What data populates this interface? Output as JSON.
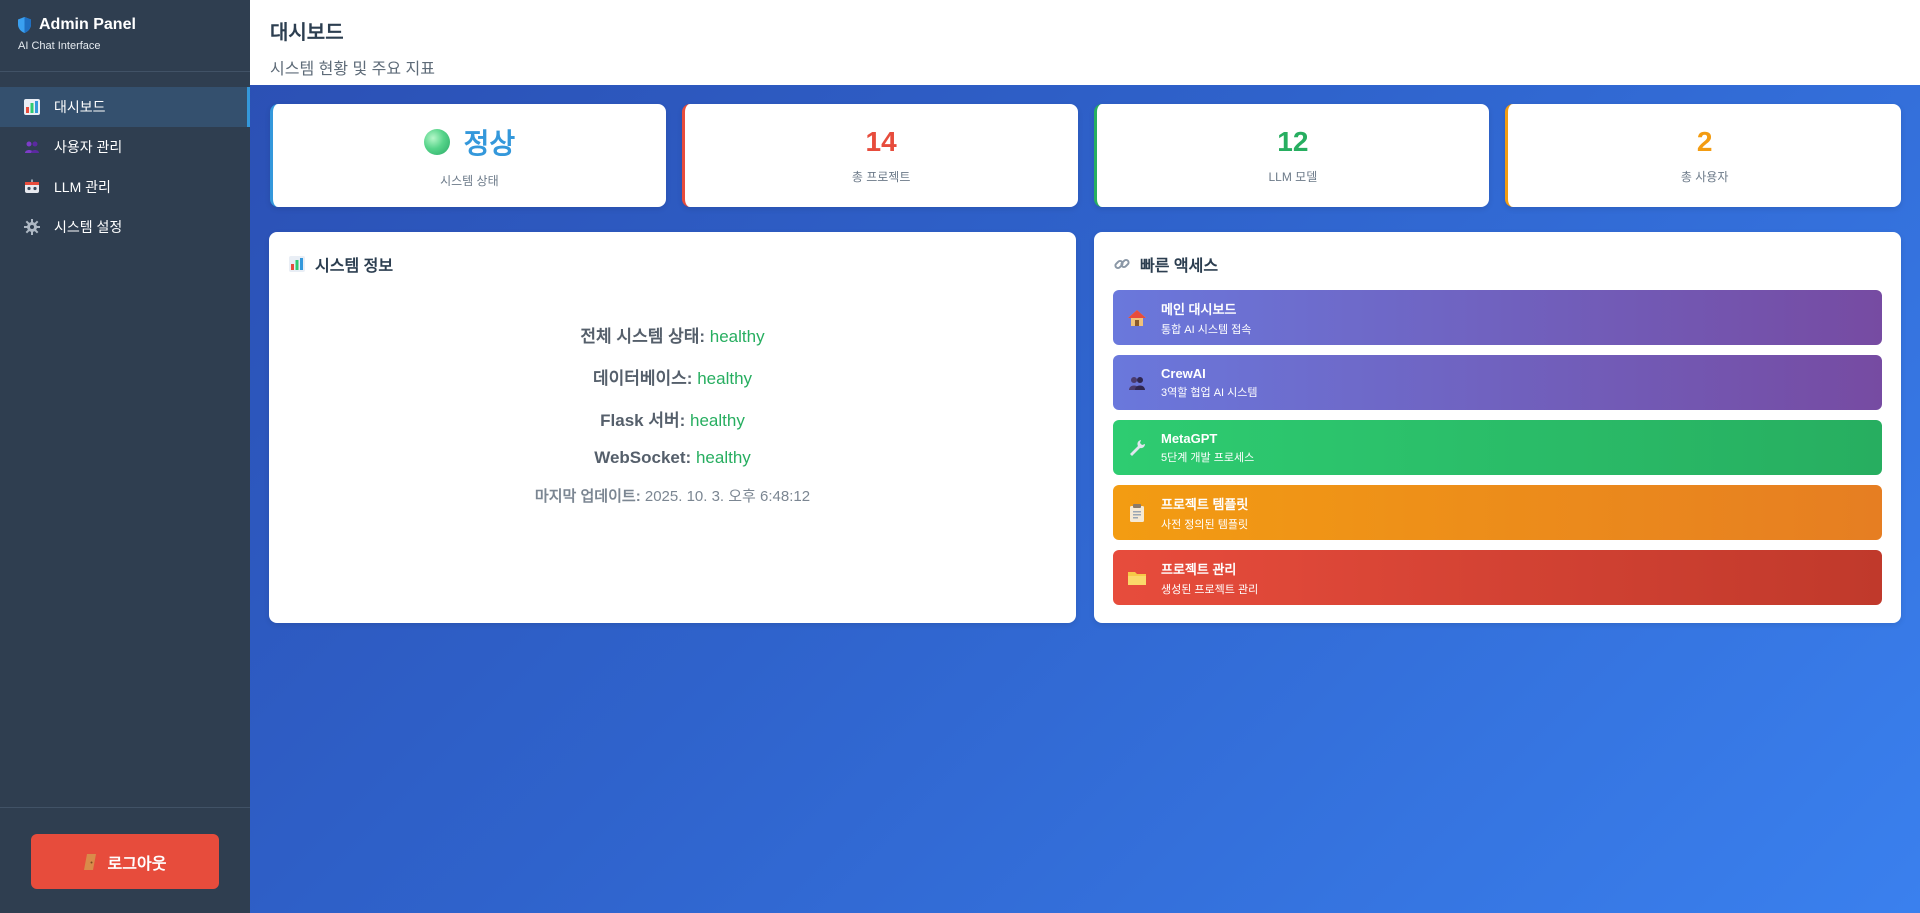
{
  "sidebar": {
    "title": "Admin Panel",
    "subtitle": "AI Chat Interface",
    "items": [
      {
        "label": "대시보드",
        "icon": "bar-chart-icon",
        "active": true
      },
      {
        "label": "사용자 관리",
        "icon": "users-icon"
      },
      {
        "label": "LLM 관리",
        "icon": "robot-icon"
      },
      {
        "label": "시스템 설정",
        "icon": "gear-icon"
      }
    ],
    "logout_label": "로그아웃"
  },
  "header": {
    "title": "대시보드",
    "subtitle": "시스템 현황 및 주요 지표"
  },
  "stats": [
    {
      "value": "정상",
      "label": "시스템 상태",
      "color": "#3498db"
    },
    {
      "value": "14",
      "label": "총 프로젝트",
      "color": "#e74c3c"
    },
    {
      "value": "12",
      "label": "LLM 모델",
      "color": "#27ae60"
    },
    {
      "value": "2",
      "label": "총 사용자",
      "color": "#f39c12"
    }
  ],
  "system_info": {
    "title": "시스템 정보",
    "rows": [
      {
        "label": "전체 시스템 상태:",
        "value": "healthy"
      },
      {
        "label": "데이터베이스:",
        "value": "healthy"
      },
      {
        "label": "Flask 서버:",
        "value": "healthy"
      },
      {
        "label": "WebSocket:",
        "value": "healthy"
      }
    ],
    "update_label": "마지막 업데이트:",
    "update_value": "2025. 10. 3. 오후 6:48:12"
  },
  "quick_access": {
    "title": "빠른 액세스",
    "items": [
      {
        "title": "메인 대시보드",
        "desc": "통합 AI 시스템 접속",
        "icon": "home-icon"
      },
      {
        "title": "CrewAI",
        "desc": "3역할 협업 AI 시스템",
        "icon": "people-icon"
      },
      {
        "title": "MetaGPT",
        "desc": "5단계 개발 프로세스",
        "icon": "wrench-icon"
      },
      {
        "title": "프로젝트 템플릿",
        "desc": "사전 정의된 템플릿",
        "icon": "clipboard-icon"
      },
      {
        "title": "프로젝트 관리",
        "desc": "생성된 프로젝트 관리",
        "icon": "folder-icon"
      }
    ]
  },
  "colors": {
    "sidebar_bg": "#2f3e50",
    "accent": "#3498db",
    "healthy": "#27ae60",
    "logout": "#e74c3c"
  }
}
